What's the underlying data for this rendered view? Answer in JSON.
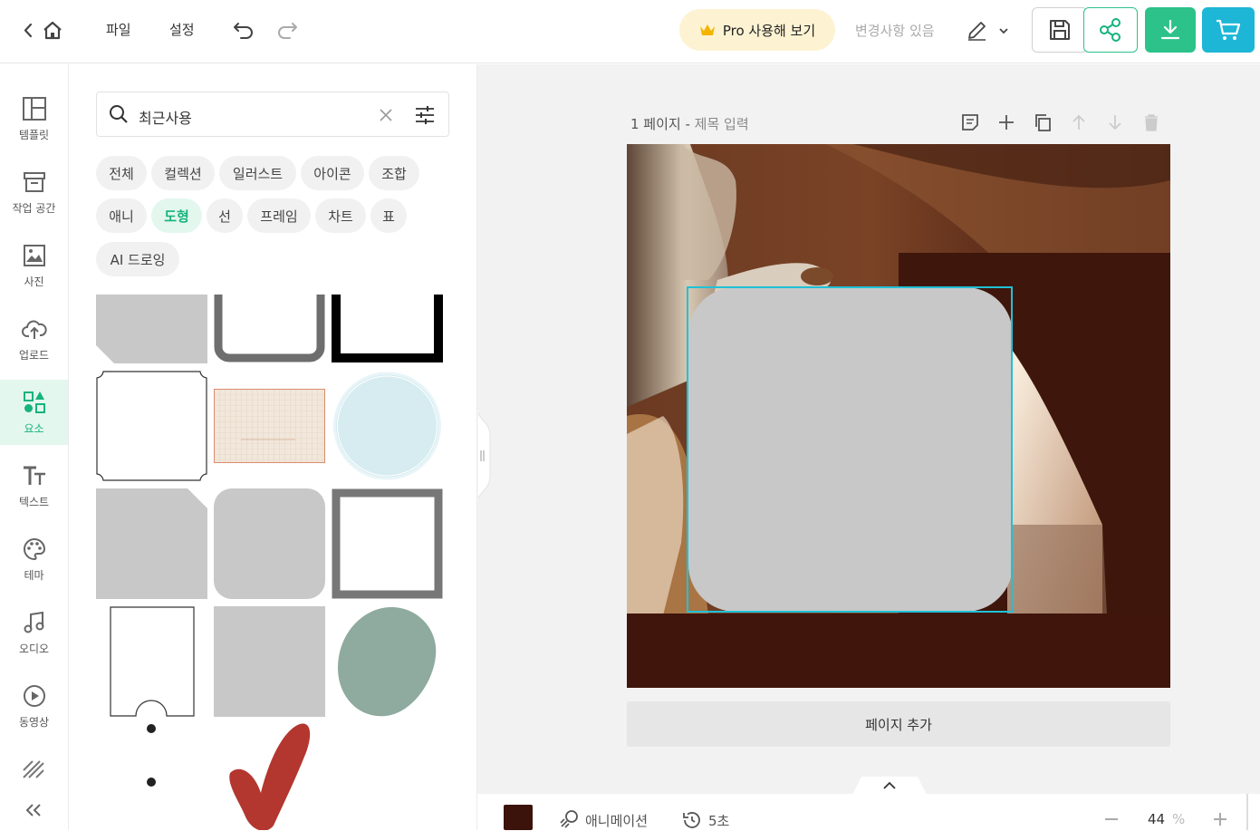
{
  "topbar": {
    "menu_file": "파일",
    "menu_settings": "설정",
    "pro_label": "Pro 사용해 보기",
    "changes_label": "변경사항 있음"
  },
  "leftnav": {
    "items": [
      {
        "label": "템플릿",
        "icon": "template-icon"
      },
      {
        "label": "작업 공간",
        "icon": "workspace-icon"
      },
      {
        "label": "사진",
        "icon": "photo-icon"
      },
      {
        "label": "업로드",
        "icon": "upload-icon"
      },
      {
        "label": "요소",
        "icon": "elements-icon",
        "active": true
      },
      {
        "label": "텍스트",
        "icon": "text-icon"
      },
      {
        "label": "테마",
        "icon": "palette-icon"
      },
      {
        "label": "오디오",
        "icon": "music-icon"
      },
      {
        "label": "동영상",
        "icon": "video-icon"
      }
    ]
  },
  "panel": {
    "search_value": "최근사용",
    "chips_row1": [
      "전체",
      "컬렉션",
      "일러스트",
      "아이콘",
      "조합"
    ],
    "chips_row2": [
      "애니",
      "도형",
      "선",
      "프레임",
      "차트",
      "표"
    ],
    "chips_row3": [
      "AI 드로잉"
    ],
    "active_chip": "도형"
  },
  "canvas": {
    "page_number": "1 페이지",
    "separator": " - ",
    "page_title_placeholder": "제목 입력",
    "add_page_label": "페이지 추가",
    "page_bg_color": "#3b130a",
    "selection_color": "#1fc1d8"
  },
  "bottombar": {
    "animation_label": "애니메이션",
    "duration_label": "5초",
    "zoom_value": "44",
    "zoom_unit": "%",
    "swatch_color": "#3b130a"
  },
  "colors": {
    "accent_green": "#16b37c",
    "download_green": "#2cc28a",
    "cart_cyan": "#1db6d6",
    "pro_bg": "#fdf3d3"
  }
}
